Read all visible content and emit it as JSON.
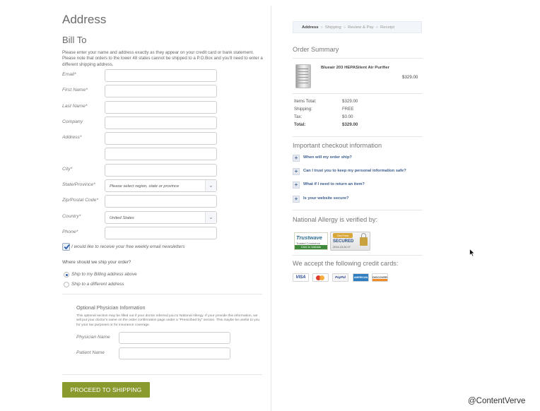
{
  "left": {
    "title": "Address",
    "subtitle": "Bill To",
    "intro": "Please enter your name and address exactly as they appear on your credit card or bank statement. Please note that orders to the lower 48 states cannot be shipped to a P.O.Box and you'll need to enter a different shipping address.",
    "fields": {
      "email": "Email*",
      "first_name": "First Name*",
      "last_name": "Last Name*",
      "company": "Company",
      "address": "Address*",
      "city": "City*",
      "state": "State/Province*",
      "zip": "Zip/Postal Code*",
      "country": "Country*",
      "phone": "Phone*"
    },
    "state_value": "Please select region, state or province",
    "country_value": "United States",
    "newsletter": "I would like to receive your free weekly email newsletters",
    "ship_question": "Where should we ship your order?",
    "ship_billing": "Ship to my Billing address above",
    "ship_different": "Ship to a different address",
    "physician": {
      "title": "Optional Physician Information",
      "note": "This optional section may be filled out if your doctor referred you to National Allergy. If your provide this information, we will put your doctor's name on the order confirmation page under a \"Prescribed by\" section. This maybe be useful to you for your tax purposes or for insurance coverage.",
      "name_label": "Physician Name",
      "patient_label": "Patient Name"
    },
    "proceed": "PROCEED TO SHIPPING"
  },
  "right": {
    "steps": {
      "address": "Address",
      "shipping": "Shipping",
      "review": "Review & Pay",
      "receipt": "Receipt",
      "separator": "»"
    },
    "summary_title": "Order Summary",
    "product_name": "Blueair 203 HEPASilent Air Purifier",
    "product_price": "$329.00",
    "totals": [
      {
        "k": "Items Total:",
        "v": "$329.00"
      },
      {
        "k": "Shipping:",
        "v": "FREE"
      },
      {
        "k": "Tax:",
        "v": "$0.00"
      },
      {
        "k": "Total:",
        "v": "$329.00"
      }
    ],
    "info_title": "Important checkout information",
    "faqs": [
      "When will my order ship?",
      "Can I trust you to keep my personal information safe?",
      "What if I need to return an item?",
      "Is your website secure?"
    ],
    "verified_title": "National Allergy is verified by:",
    "trustwave": {
      "name": "Trustwave",
      "sub": "Trusted Commerce",
      "bar": "Click to Validate"
    },
    "geotrust": {
      "top": "GeoTrust",
      "mid": "SECURED",
      "date": "2014-10-24 07"
    },
    "cards_title": "We accept the following credit cards:",
    "cards": {
      "visa": "VISA",
      "paypal": "PayPal",
      "amex": "AMERICAN EXPRESS",
      "discover": "DISCOVER"
    }
  },
  "watermark": "@ContentVerve",
  "colors": {
    "accent_button": "#8a9a2e",
    "link": "#3d5e8e",
    "radio_selected": "#2a5db0"
  }
}
